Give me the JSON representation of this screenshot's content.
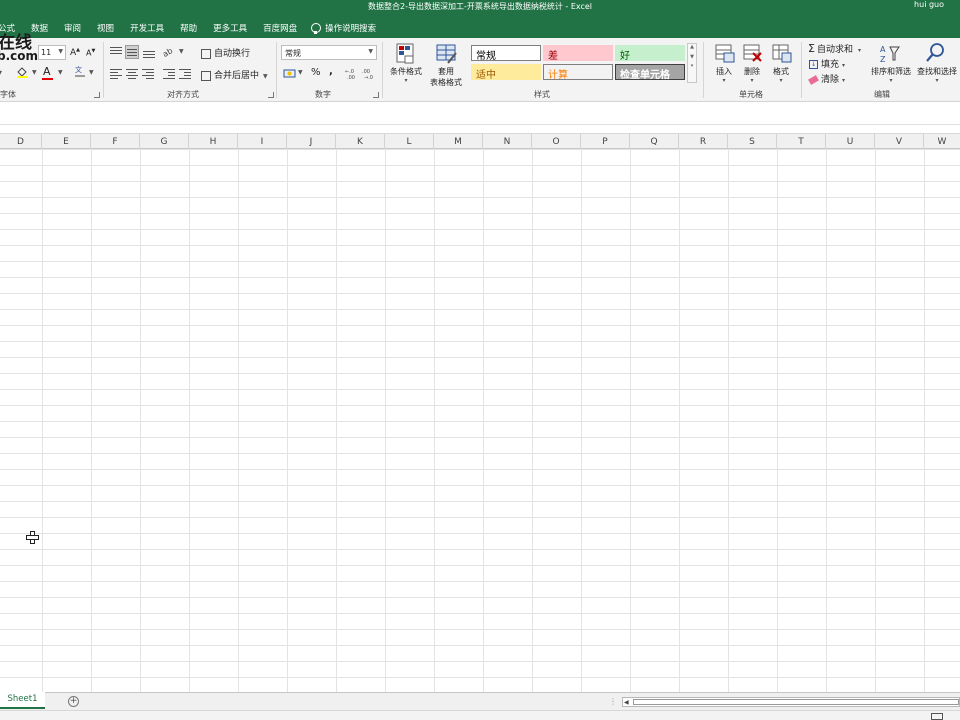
{
  "window": {
    "title": "数据整合2-导出数据深加工-开票系统导出数据纳税统计  -  Excel",
    "user": "hui guo"
  },
  "tabs": [
    "公式",
    "数据",
    "审阅",
    "视图",
    "开发工具",
    "帮助",
    "更多工具",
    "百度网盘"
  ],
  "tell_me": "操作说明搜索",
  "watermark": {
    "line1": "在线",
    "line2": "b.com"
  },
  "ribbon": {
    "font": {
      "size": "11",
      "grow": "A",
      "shrink": "A",
      "label": "字体",
      "font_color_glyph": "A"
    },
    "alignment": {
      "wrap_text": "自动换行",
      "merge_center": "合并后居中",
      "label": "对齐方式"
    },
    "number": {
      "format": "常规",
      "percent": "%",
      "comma": ",",
      "label": "数字"
    },
    "styles": {
      "conditional_formatting": "条件格式",
      "format_as_table_line1": "套用",
      "format_as_table_line2": "表格格式",
      "cells": [
        {
          "text": "常规",
          "bg": "#ffffff",
          "fg": "#000000",
          "border": "#7f7f7f"
        },
        {
          "text": "差",
          "bg": "#ffc7ce",
          "fg": "#9c0006",
          "border": "#ffc7ce"
        },
        {
          "text": "好",
          "bg": "#c6efce",
          "fg": "#006100",
          "border": "#c6efce"
        },
        {
          "text": "适中",
          "bg": "#ffeb9c",
          "fg": "#9c5700",
          "border": "#ffeb9c"
        },
        {
          "text": "计算",
          "bg": "#f2f2f2",
          "fg": "#fa7d00",
          "border": "#7f7f7f"
        },
        {
          "text": "检查单元格",
          "bg": "#a5a5a5",
          "fg": "#ffffff",
          "border": "#3f3f3f"
        }
      ],
      "label": "样式"
    },
    "cells": {
      "insert": "插入",
      "delete": "删除",
      "format": "格式",
      "label": "单元格"
    },
    "editing": {
      "autosum": "自动求和",
      "fill": "填充",
      "clear": "清除",
      "sort_filter": "排序和筛选",
      "find_select": "查找和选择",
      "label": "编辑"
    }
  },
  "columns": [
    "D",
    "E",
    "F",
    "G",
    "H",
    "I",
    "J",
    "K",
    "L",
    "M",
    "N",
    "O",
    "P",
    "Q",
    "R",
    "S",
    "T",
    "U",
    "V",
    "W"
  ],
  "sheets": [
    "Sheet1"
  ],
  "colors": {
    "accent": "#217346"
  }
}
